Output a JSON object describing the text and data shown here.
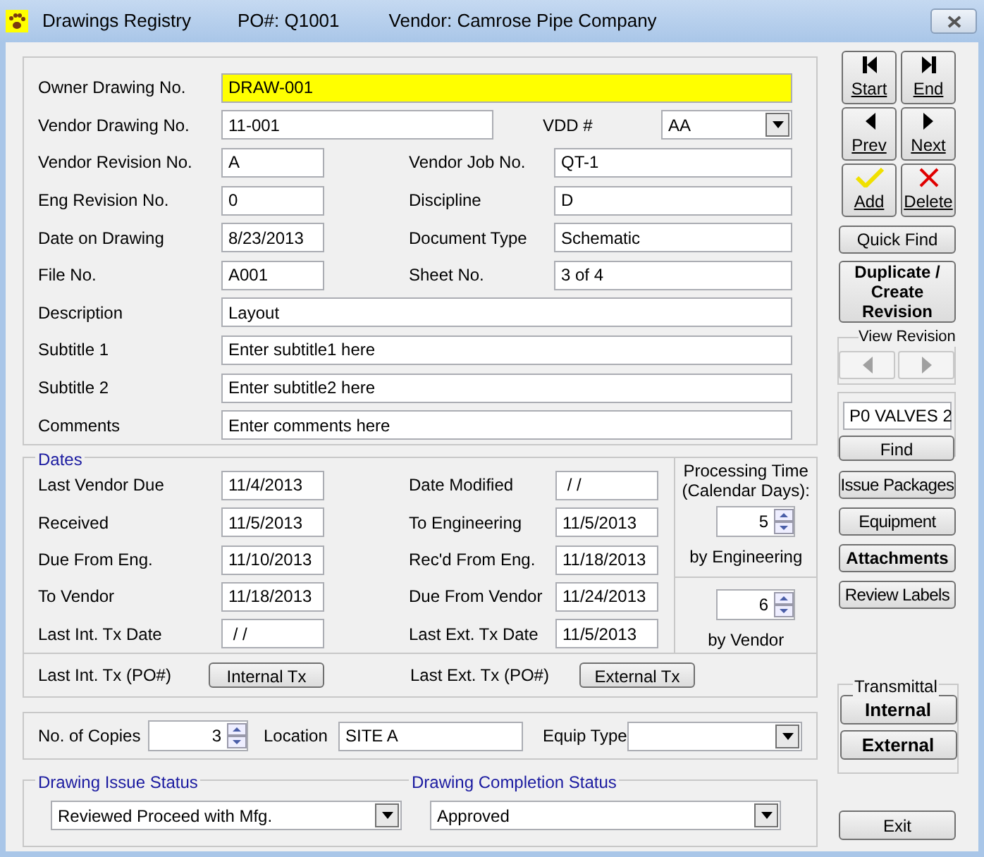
{
  "window": {
    "title": "Drawings Registry",
    "po": "PO#: Q1001",
    "vendor": "Vendor: Camrose Pipe Company"
  },
  "fields": [
    [
      {
        "label": "Owner Drawing No.",
        "value": "DRAW-001",
        "kind": "wide",
        "highlighted": true
      }
    ],
    [
      {
        "label": "Vendor Drawing No.",
        "value": "11-001",
        "kind": "long"
      },
      {
        "label": "VDD #",
        "value": "AA",
        "kind": "select"
      }
    ],
    [
      {
        "label": "Vendor Revision No.",
        "value": "A",
        "kind": "short"
      },
      {
        "label": "Vendor Job No.",
        "value": "QT-1",
        "kind": "text"
      }
    ],
    [
      {
        "label": "Eng Revision No.",
        "value": "0",
        "kind": "short"
      },
      {
        "label": "Discipline",
        "value": "D",
        "kind": "text"
      }
    ],
    [
      {
        "label": "Date on Drawing",
        "value": "8/23/2013",
        "kind": "short"
      },
      {
        "label": "Document Type",
        "value": "Schematic",
        "kind": "text"
      }
    ],
    [
      {
        "label": "File No.",
        "value": "A001",
        "kind": "short"
      },
      {
        "label": "Sheet No.",
        "value": "3 of 4",
        "kind": "text"
      }
    ],
    [
      {
        "label": "Description",
        "value": "Layout",
        "kind": "wide"
      }
    ],
    [
      {
        "label": "Subtitle 1",
        "value": "Enter subtitle1 here",
        "kind": "wide"
      }
    ],
    [
      {
        "label": "Subtitle 2",
        "value": "Enter subtitle2 here",
        "kind": "wide"
      }
    ],
    [
      {
        "label": "Comments",
        "value": "Enter comments here",
        "kind": "wide"
      }
    ]
  ],
  "dates": {
    "legend": "Dates",
    "rows": [
      [
        {
          "label": "Last Vendor Due",
          "value": "11/4/2013"
        },
        {
          "label": "Date Modified",
          "value": " / /"
        }
      ],
      [
        {
          "label": "Received",
          "value": "11/5/2013"
        },
        {
          "label": "To Engineering",
          "value": "11/5/2013"
        }
      ],
      [
        {
          "label": "Due From Eng.",
          "value": "11/10/2013"
        },
        {
          "label": "Rec'd From Eng.",
          "value": "11/18/2013"
        }
      ],
      [
        {
          "label": "To Vendor",
          "value": "11/18/2013"
        },
        {
          "label": "Due From Vendor",
          "value": "11/24/2013"
        }
      ],
      [
        {
          "label": "Last Int. Tx Date",
          "value": " / /"
        },
        {
          "label": "Last Ext. Tx Date",
          "value": "11/5/2013"
        }
      ]
    ],
    "processing": {
      "title": "Processing Time (Calendar Days):",
      "spinners": [
        {
          "value": "5",
          "label": "by Engineering"
        },
        {
          "value": "6",
          "label": "by Vendor"
        }
      ]
    },
    "tx": [
      {
        "label": "Last Int. Tx (PO#)",
        "button": "Internal Tx"
      },
      {
        "label": "Last Ext. Tx (PO#)",
        "button": "External Tx"
      }
    ]
  },
  "copies": {
    "label": "No. of Copies",
    "value": "3",
    "location_label": "Location",
    "location": "SITE A",
    "equip_label": "Equip Type"
  },
  "status": [
    {
      "legend": "Drawing Issue Status",
      "value": "Reviewed Proceed with Mfg."
    },
    {
      "legend": "Drawing Completion Status",
      "value": "Approved"
    }
  ],
  "sidebar": {
    "nav": [
      {
        "label": "Start",
        "kind": "first"
      },
      {
        "label": "End",
        "kind": "last"
      },
      {
        "label": "Prev",
        "kind": "prev"
      },
      {
        "label": "Next",
        "kind": "next"
      },
      {
        "label": "Add",
        "kind": "add"
      },
      {
        "label": "Delete",
        "kind": "delete"
      }
    ],
    "quick_find": "Quick Find",
    "duplicate": "Duplicate / Create Revision",
    "view_revision": {
      "legend": "View Revision",
      "disabled": true
    },
    "find": {
      "value": "P0 VALVES 2",
      "button": "Find"
    },
    "buttons": [
      {
        "label": "Issue Packages",
        "bold": false
      },
      {
        "label": "Equipment",
        "bold": false
      },
      {
        "label": "Attachments",
        "bold": true
      },
      {
        "label": "Review Labels",
        "bold": false
      }
    ],
    "transmittal": {
      "legend": "Transmittal",
      "buttons": [
        "Internal",
        "External"
      ]
    },
    "exit": "Exit"
  }
}
